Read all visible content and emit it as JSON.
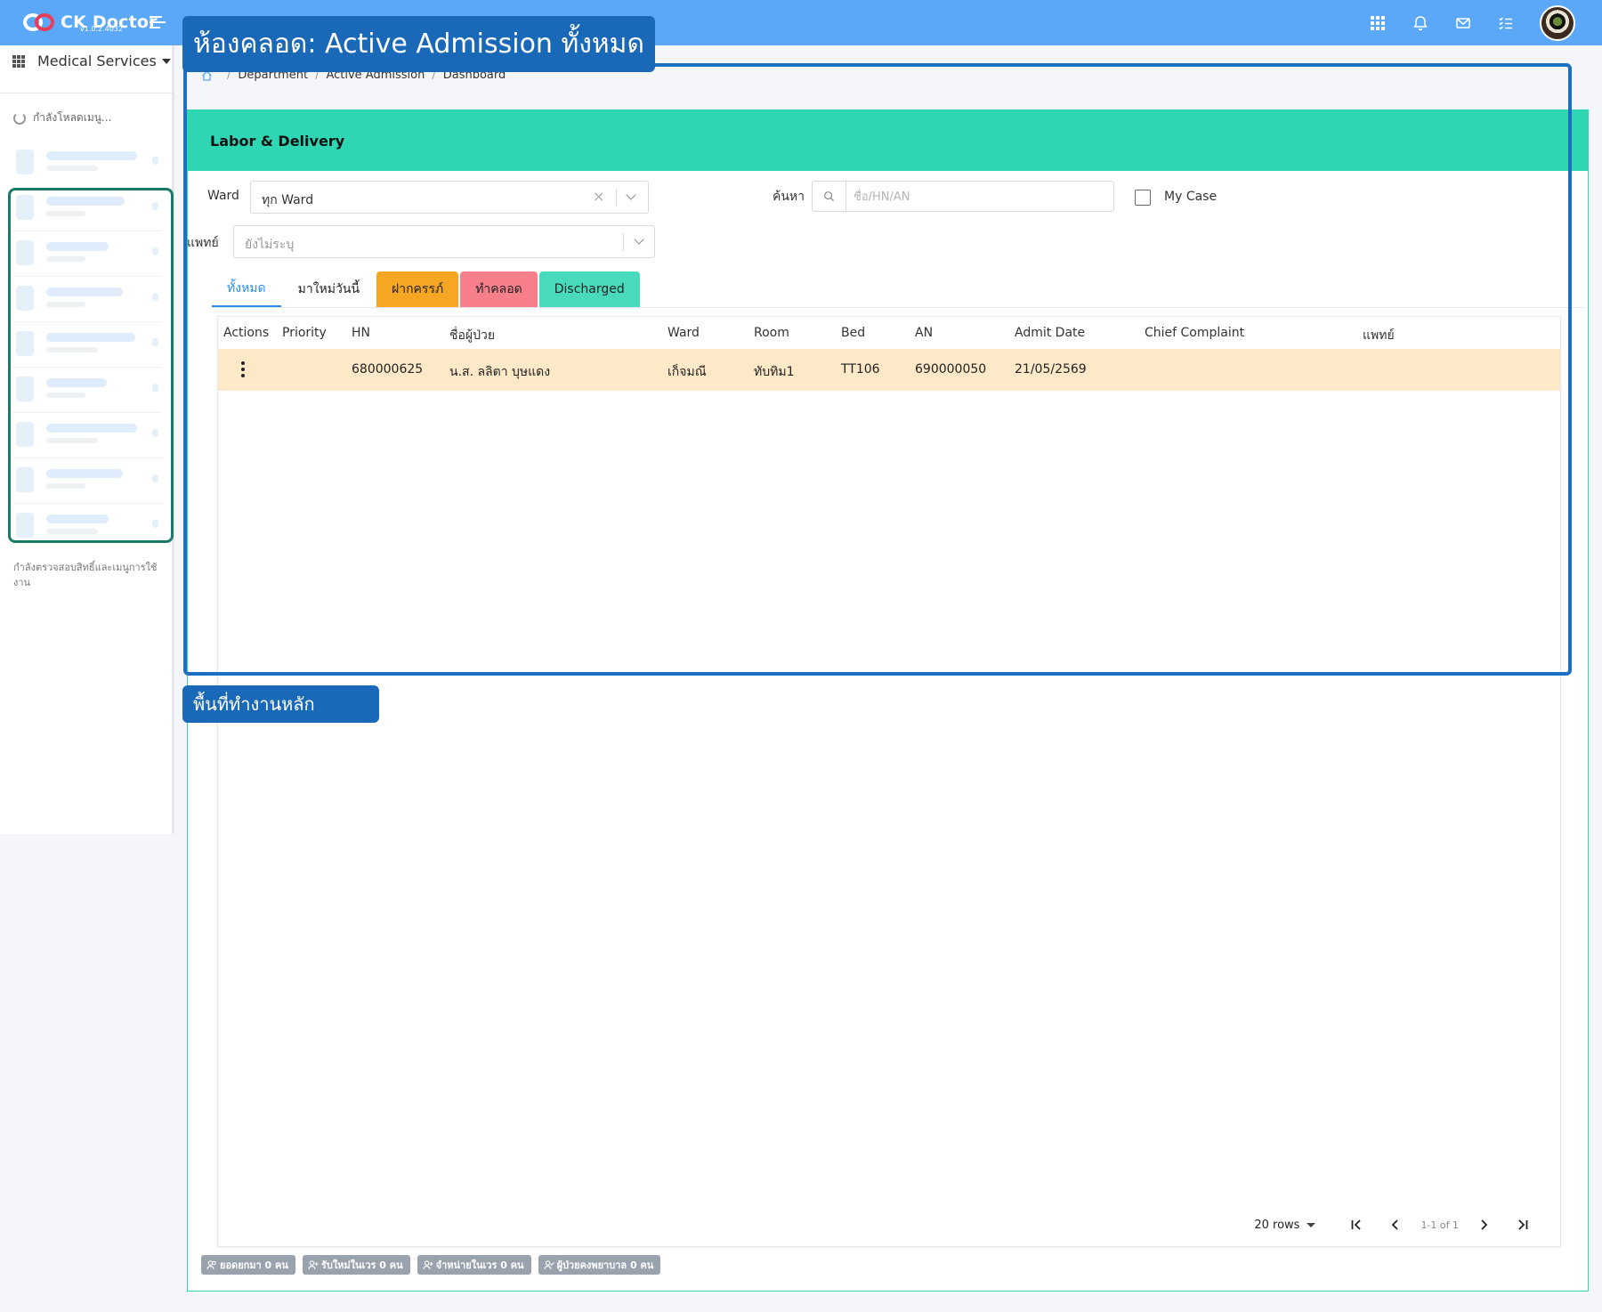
{
  "app": {
    "name": "CK Doctor",
    "version": "v1.0.2.4032"
  },
  "sidebar": {
    "service_select": "Medical Services",
    "loading_text": "กำลังโหลดเมนู...",
    "permission_text": "กำลังตรวจสอบสิทธิ์และเมนูการใช้งาน"
  },
  "breadcrumb": [
    "Department",
    "Active Admission",
    "Dashboard"
  ],
  "card": {
    "title": "Labor & Delivery"
  },
  "filters": {
    "ward_label": "Ward",
    "ward_value": "ทุก Ward",
    "search_label": "ค้นหา",
    "search_placeholder": "ชื่อ/HN/AN",
    "mycase_label": "My Case",
    "doctor_label": "แพทย์",
    "doctor_placeholder": "ยังไม่ระบุ"
  },
  "tabs": [
    {
      "label": "ทั้งหมด",
      "active": true,
      "color": ""
    },
    {
      "label": "มาใหม่วันนี้",
      "active": false,
      "color": ""
    },
    {
      "label": "ฝากครรภ์",
      "active": false,
      "color": "#f5a623"
    },
    {
      "label": "ทำคลอด",
      "active": false,
      "color": "#f77f8c"
    },
    {
      "label": "Discharged",
      "active": false,
      "color": "#48dbbb"
    }
  ],
  "table": {
    "columns": [
      "Actions",
      "Priority",
      "HN",
      "ชื่อผู้ป่วย",
      "Ward",
      "Room",
      "Bed",
      "AN",
      "Admit Date",
      "Chief Complaint",
      "แพทย์"
    ],
    "rows": [
      {
        "priority": "",
        "hn": "680000625",
        "patient_name": "น.ส. ลลิตา บุษแดง",
        "ward": "เก็จมณี",
        "room": "ทับทิม1",
        "bed": "TT106",
        "an": "690000050",
        "admit_date": "21/05/2569",
        "chief_complaint": "",
        "doctor": ""
      }
    ],
    "row_color": "#fde8c8"
  },
  "pager": {
    "rows_per_page": "20 rows",
    "info": "1-1 of 1"
  },
  "footer_badges": [
    "ยอดยกมา 0 คน",
    "รับใหม่ในเวร 0 คน",
    "จำหน่ายในเวร 0 คน",
    "ผู้ป่วยคงพยาบาล 0 คน"
  ],
  "annotations": {
    "region_title": "ห้องคลอด: Active Admission ทั้งหมด",
    "workspace_label": "พื้นที่ทำงานหลัก"
  },
  "colors": {
    "header_blue": "#5aa8f7",
    "card_header_teal": "#2fd6b4",
    "annotation_blue": "#1a68b8",
    "sidebar_highlight": "#1a7a66"
  }
}
